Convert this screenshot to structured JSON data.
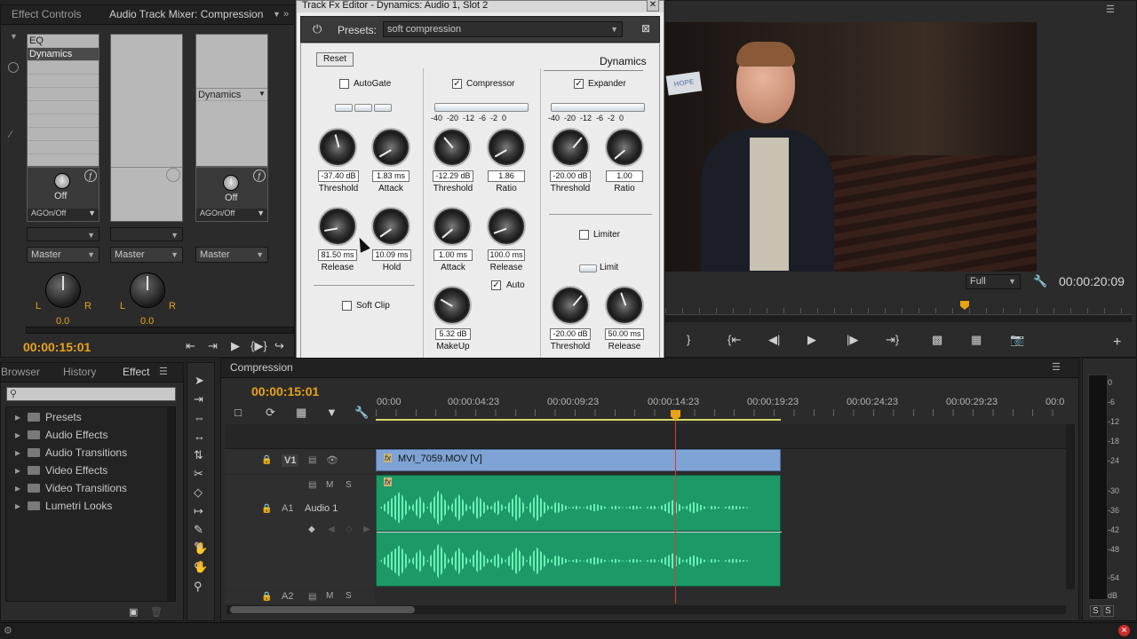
{
  "top_tabs": {
    "effect_controls": "Effect Controls",
    "audio_mixer": "Audio Track Mixer: Compression"
  },
  "mixer": {
    "ch1_slots": [
      "EQ",
      "Dynamics",
      "",
      "",
      "",
      "",
      "",
      "",
      ""
    ],
    "ch3_slot_label": "Dynamics",
    "off_label": "Off",
    "agc_label": "AGOn/Off",
    "master_label": "Master",
    "pan_value": "0.0",
    "L": "L",
    "R": "R",
    "timecode": "00:00:15:01"
  },
  "dialog": {
    "title": "Track Fx Editor - Dynamics: Audio 1, Slot 2",
    "presets_label": "Presets:",
    "preset_value": "soft compression",
    "reset": "Reset",
    "dynamics": "Dynamics",
    "autogate": "AutoGate",
    "compressor": "Compressor",
    "expander": "Expander",
    "limiter": "Limiter",
    "limit": "Limit",
    "soft_clip": "Soft Clip",
    "auto": "Auto",
    "ticks": "-40  -20  -12  -6  -2  0",
    "gate": {
      "threshold": "-37.40 dB",
      "attack": "1.83 ms",
      "release": "81.50 ms",
      "hold": "10.09 ms"
    },
    "comp": {
      "threshold": "-12.29 dB",
      "ratio": "1.86",
      "attack": "1.00 ms",
      "release": "100.0 ms",
      "makeup": "5.32 dB"
    },
    "exp": {
      "threshold": "-20.00 dB",
      "ratio": "1.00"
    },
    "lim": {
      "threshold": "-20.00 dB",
      "release": "50.00 ms"
    },
    "labels": {
      "threshold": "Threshold",
      "attack": "Attack",
      "release": "Release",
      "hold": "Hold",
      "ratio": "Ratio",
      "makeup": "MakeUp"
    }
  },
  "monitor": {
    "zoom": "Full",
    "timecode": "00:00:20:09"
  },
  "project": {
    "tabs": [
      "Browser",
      "History",
      "Effect"
    ],
    "items": [
      "Presets",
      "Audio Effects",
      "Audio Transitions",
      "Video Effects",
      "Video Transitions",
      "Lumetri Looks"
    ]
  },
  "timeline": {
    "tab": "Compression",
    "timecode": "00:00:15:01",
    "ruler": [
      "00:00",
      "00:00:04:23",
      "00:00:09:23",
      "00:00:14:23",
      "00:00:19:23",
      "00:00:24:23",
      "00:00:29:23",
      "00:0"
    ],
    "v1": "V1",
    "a1": "A1",
    "a2": "A2",
    "audio1": "Audio 1",
    "M": "M",
    "S": "S",
    "video_clip": "MVI_7059.MOV [V]",
    "fx": "fx"
  },
  "meter": {
    "scale": [
      "0",
      "-6",
      "-12",
      "-18",
      "-24",
      "-30",
      "-36",
      "-42",
      "-48",
      "-54",
      "dB"
    ],
    "solo": "S"
  }
}
